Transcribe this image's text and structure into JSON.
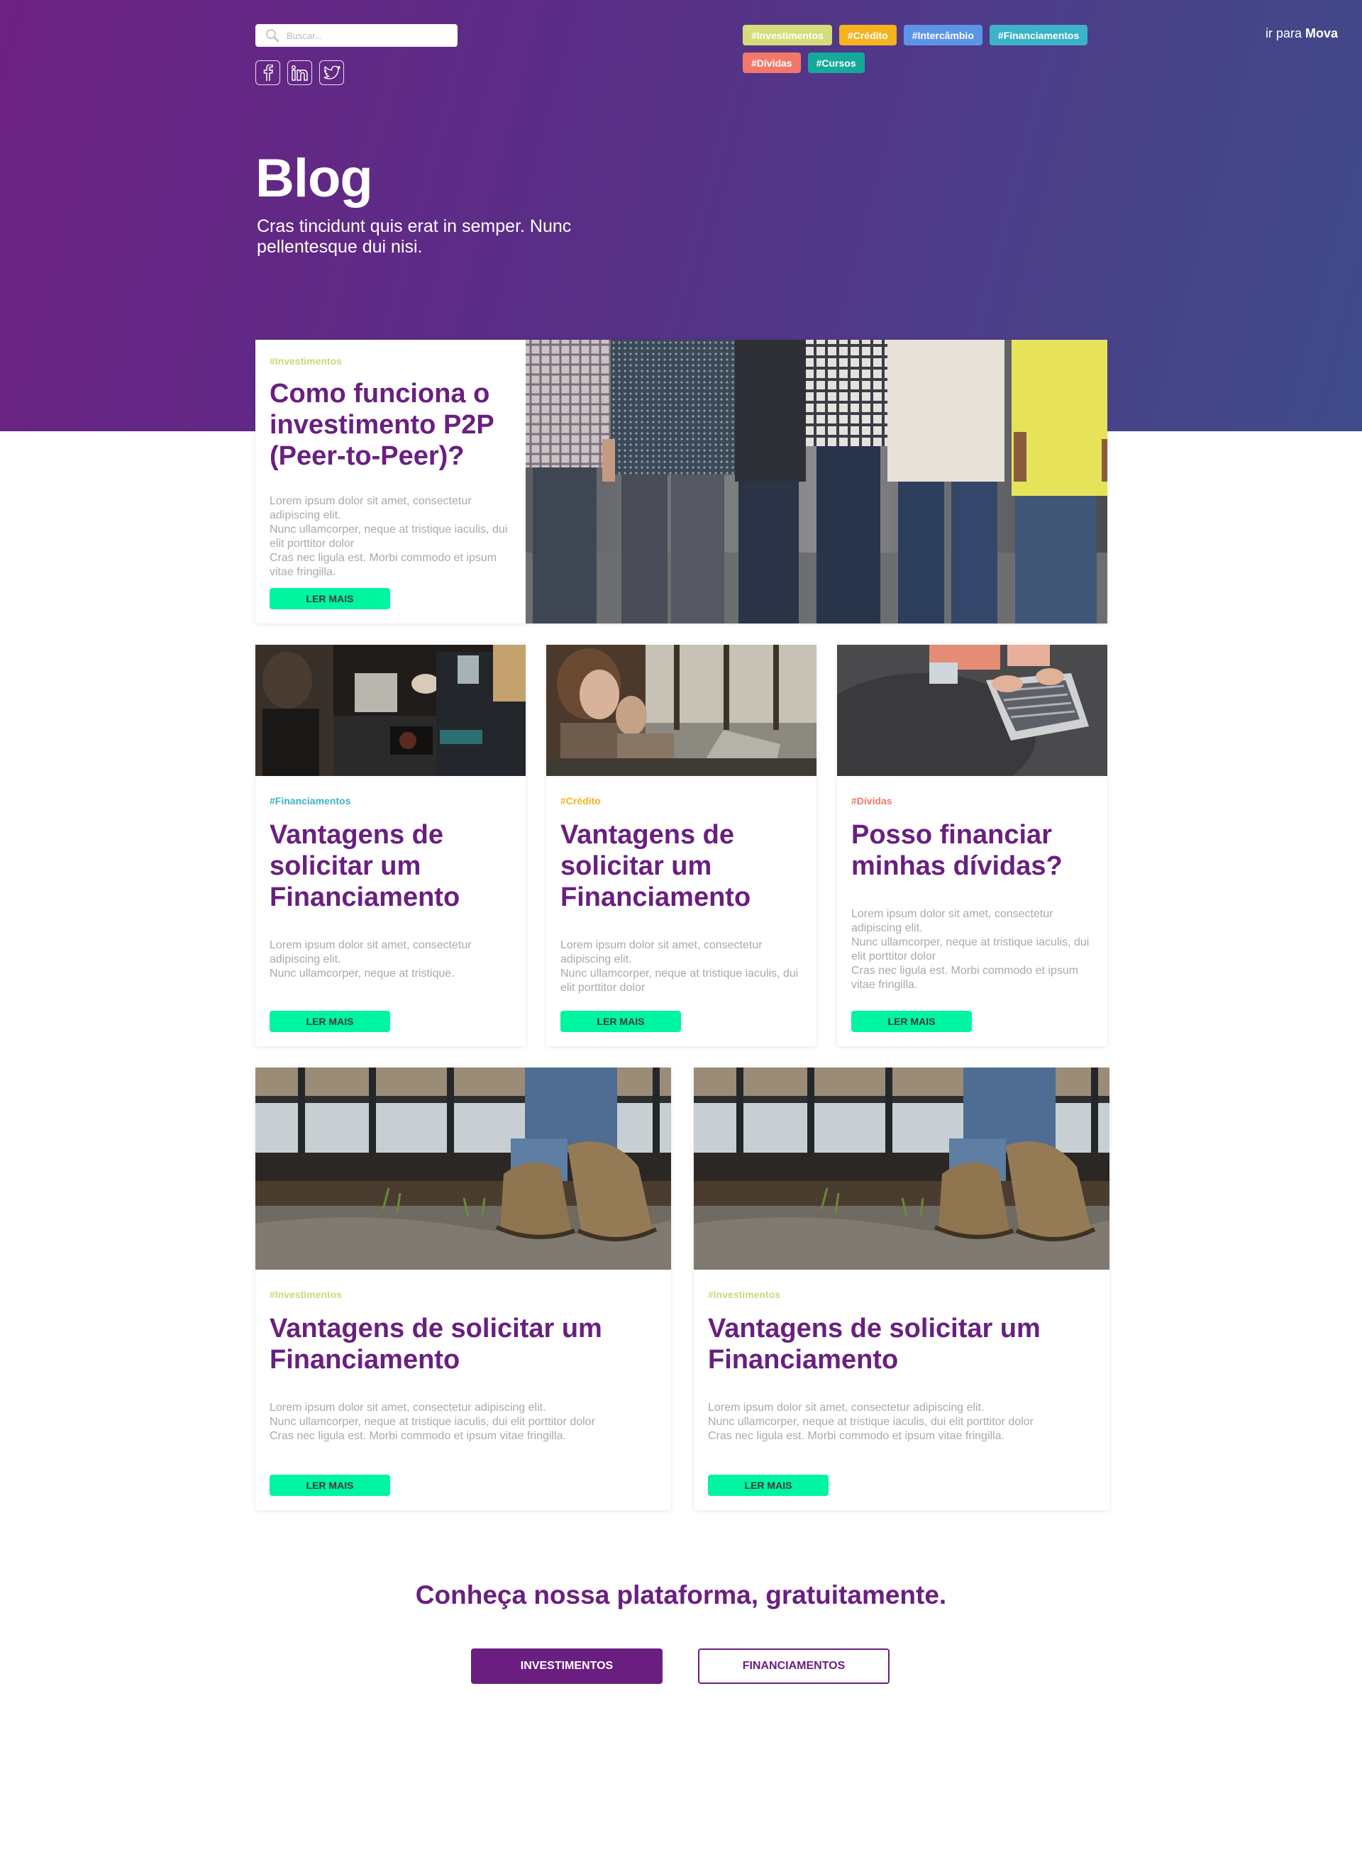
{
  "header": {
    "search_placeholder": "Buscar...",
    "tags": [
      {
        "label": "#Investimentos",
        "color": "#d4dd7a"
      },
      {
        "label": "#Crédito",
        "color": "#f5b320"
      },
      {
        "label": "#Intercâmbio",
        "color": "#5c95e8"
      },
      {
        "label": "#Financiamentos",
        "color": "#3bb3c9"
      },
      {
        "label": "#Dívidas",
        "color": "#f2786a"
      },
      {
        "label": "#Cursos",
        "color": "#15a99a"
      }
    ],
    "goto_prefix": "ir para",
    "goto_brand": "Mova",
    "social": [
      "facebook-icon",
      "linkedin-icon",
      "twitter-icon"
    ]
  },
  "hero": {
    "title": "Blog",
    "subtitle": "Cras tincidunt quis erat in semper. Nunc pellentesque dui nisi."
  },
  "featured": {
    "tag": "#Investimentos",
    "tag_color": "#cfd67a",
    "title": "Como funciona o investimento P2P (Peer-to-Peer)?",
    "text": "Lorem ipsum dolor sit amet, consectetur adipiscing elit.\nNunc ullamcorper, neque at tristique iaculis, dui elit porttitor dolor\nCras nec ligula est. Morbi commodo et ipsum vitae fringilla.",
    "button": "LER MAIS"
  },
  "cards_row1": [
    {
      "tag": "#Financiamentos",
      "tag_color": "#3bb3c9",
      "title": "Vantagens de solicitar um Financiamento",
      "text": "Lorem ipsum dolor sit amet, consectetur adipiscing elit.\nNunc ullamcorper, neque at tristique.",
      "button": "LER MAIS"
    },
    {
      "tag": "#Crédito",
      "tag_color": "#f5b320",
      "title": "Vantagens de solicitar um Financiamento",
      "text": "Lorem ipsum dolor sit amet, consectetur adipiscing elit.\nNunc ullamcorper, neque at tristique iaculis, dui elit porttitor dolor",
      "button": "LER MAIS"
    },
    {
      "tag": "#Dívidas",
      "tag_color": "#f2786a",
      "title": "Posso financiar minhas dívidas?",
      "text": "Lorem ipsum dolor sit amet, consectetur adipiscing elit.\nNunc ullamcorper, neque at tristique iaculis, dui elit porttitor dolor\nCras nec ligula est. Morbi commodo et ipsum vitae fringilla.",
      "button": "LER MAIS"
    }
  ],
  "cards_row2": [
    {
      "tag": "#Investimentos",
      "tag_color": "#cfd67a",
      "title": "Vantagens de solicitar um Financiamento",
      "text": "Lorem ipsum dolor sit amet, consectetur adipiscing elit.\nNunc ullamcorper, neque at tristique iaculis, dui elit porttitor dolor\nCras nec ligula est. Morbi commodo et ipsum vitae fringilla.",
      "button": "LER MAIS"
    },
    {
      "tag": "#Investimentos",
      "tag_color": "#cfd67a",
      "title": "Vantagens de solicitar um Financiamento",
      "text": "Lorem ipsum dolor sit amet, consectetur adipiscing elit.\nNunc ullamcorper, neque at tristique iaculis, dui elit porttitor dolor\nCras nec ligula est. Morbi commodo et ipsum vitae fringilla.",
      "button": "LER MAIS"
    }
  ],
  "cta": {
    "title": "Conheça nossa plataforma, gratuitamente.",
    "primary": "INVESTIMENTOS",
    "secondary": "FINANCIAMENTOS"
  },
  "colors": {
    "brand_purple": "#6a1f80",
    "accent_green": "#00f5a0",
    "hero_gradient_start": "#6d2284",
    "hero_gradient_end": "#3f4c8a"
  }
}
